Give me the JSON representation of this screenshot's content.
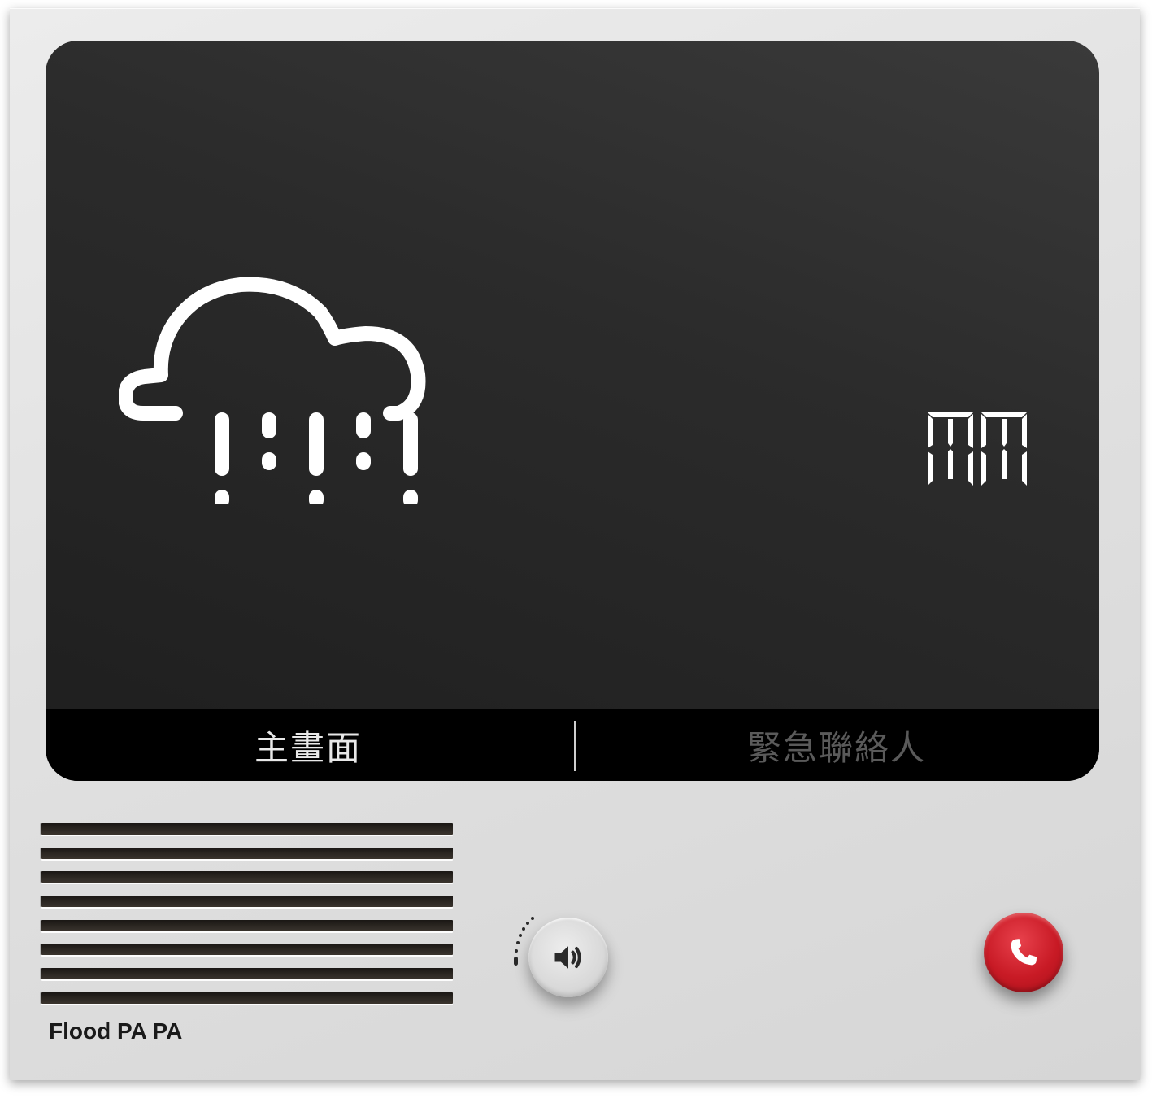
{
  "screen": {
    "weather_icon": "rain-cloud-icon",
    "unit_display": "MM",
    "tabs": [
      {
        "label": "主畫面",
        "active": true
      },
      {
        "label": "緊急聯絡人",
        "active": false
      }
    ]
  },
  "speaker": {
    "slots": 8
  },
  "brand": {
    "name": "Flood PA PA"
  },
  "controls": {
    "volume_icon": "speaker-volume-icon",
    "call_icon": "phone-icon",
    "call_color": "#c81a25"
  },
  "colors": {
    "screen_bg": "#2b2b2b",
    "tab_bar_bg": "#000000",
    "active_tab_text": "#e8e8e8",
    "inactive_tab_text": "#5a5a5a",
    "device_body": "#e1e1e1"
  }
}
